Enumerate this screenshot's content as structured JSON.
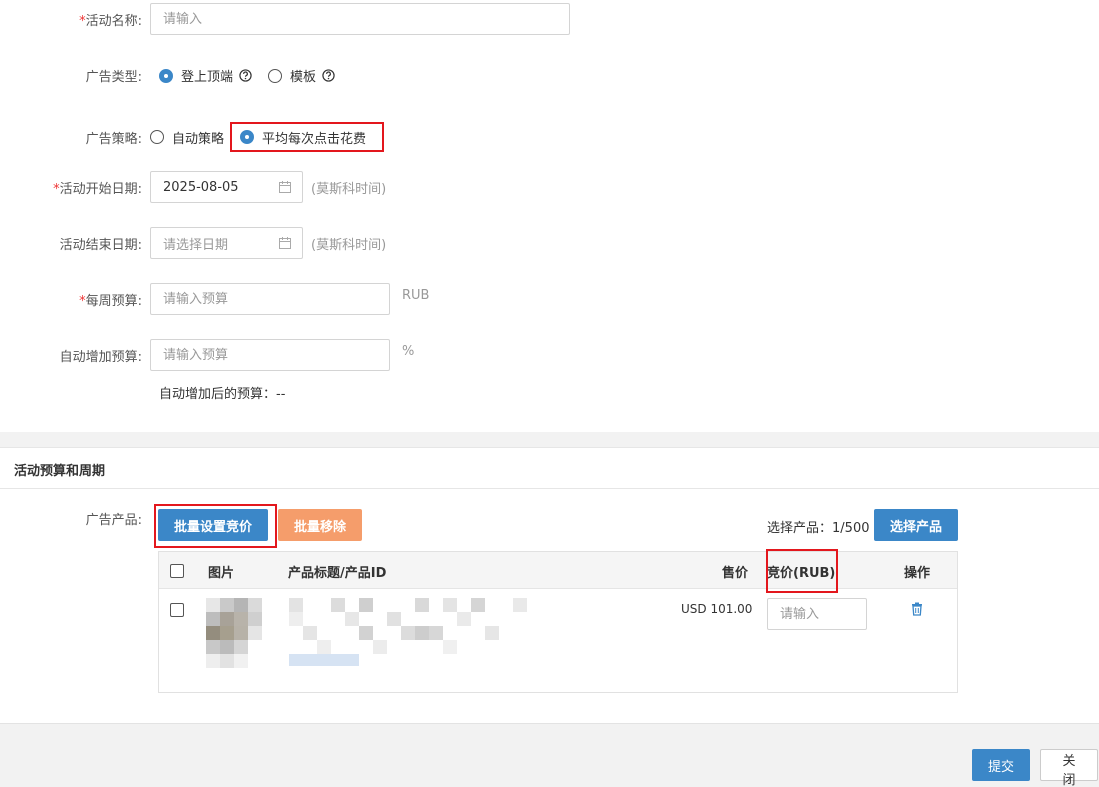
{
  "form": {
    "name_label": "活动名称",
    "name_placeholder": "请输入",
    "type_label": "广告类型",
    "type_options": [
      "登上顶端",
      "模板"
    ],
    "strategy_label": "广告策略",
    "strategy_options": [
      "自动策略",
      "平均每次点击花费"
    ],
    "start_label": "活动开始日期",
    "start_value": "2025-08-05",
    "end_label": "活动结束日期",
    "end_placeholder": "请选择日期",
    "tz_note": "(莫斯科时间)",
    "weekly_label": "每周预算",
    "weekly_placeholder": "请输入预算",
    "weekly_unit": "RUB",
    "auto_label": "自动增加预算",
    "auto_placeholder": "请输入预算",
    "auto_unit": "%",
    "after_label": "自动增加后的预算：",
    "after_value": "--",
    "colon": ":",
    "required_mark": "*"
  },
  "section": {
    "title": "活动预算和周期",
    "products_label": "广告产品",
    "bulk_bid_btn": "批量设置竞价",
    "bulk_remove_btn": "批量移除",
    "select_count_label": "选择产品：",
    "select_count": "1/500",
    "select_btn": "选择产品"
  },
  "table": {
    "headers": {
      "image": "图片",
      "title": "产品标题/产品ID",
      "price": "售价",
      "bid": "竞价(RUB)",
      "action": "操作"
    },
    "rows": [
      {
        "price": "USD 101.00",
        "bid_placeholder": "请输入"
      }
    ]
  },
  "footer": {
    "submit": "提交",
    "close": "关闭"
  },
  "colors": {
    "primary": "#3b87c8",
    "warning": "#f59d6b",
    "highlight": "#e3171d",
    "required": "#ee3333"
  }
}
